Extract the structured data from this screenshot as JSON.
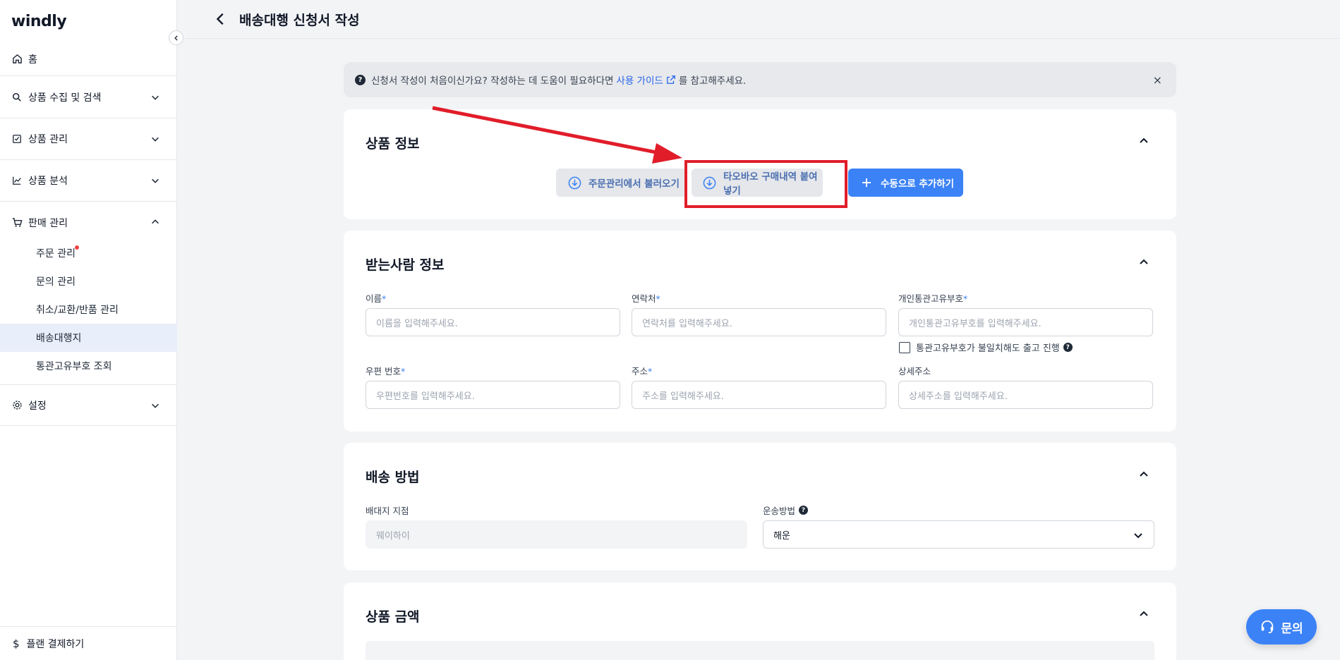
{
  "app": {
    "logo": "windly"
  },
  "sidebar": {
    "home": "홈",
    "sections": [
      {
        "label": "상품 수집 및 검색",
        "icon": "search-icon"
      },
      {
        "label": "상품 관리",
        "icon": "checklist-icon"
      },
      {
        "label": "상품 분석",
        "icon": "chart-icon"
      },
      {
        "label": "판매 관리",
        "icon": "cart-icon",
        "expanded": true
      },
      {
        "label": "설정",
        "icon": "gear-icon"
      }
    ],
    "sub_items": [
      "주문 관리",
      "문의 관리",
      "취소/교환/반품 관리",
      "배송대행지",
      "통관고유부호 조회"
    ],
    "active_sub_item": "배송대행지",
    "plan": "플랜 결제하기"
  },
  "header": {
    "title": "배송대행 신청서 작성"
  },
  "banner": {
    "text_before": "신청서 작성이 처음이신가요? 작성하는 데 도움이 필요하다면",
    "link": "사용 가이드",
    "text_after": "를 참고해주세요.",
    "close": "×"
  },
  "product_info": {
    "title": "상품 정보",
    "buttons": {
      "import_orders": "주문관리에서 불러오기",
      "taobao": "타오바오 구매내역 붙여넣기",
      "manual": "수동으로 추가하기"
    }
  },
  "recipient": {
    "title": "받는사람 정보",
    "fields": {
      "name": {
        "label": "이름",
        "req": "*",
        "placeholder": "이름을 입력해주세요."
      },
      "phone": {
        "label": "연락처",
        "req": "*",
        "placeholder": "연락처를 입력해주세요."
      },
      "customs": {
        "label": "개인통관고유부호",
        "req": "*",
        "placeholder": "개인통관고유부호를 입력해주세요."
      },
      "zip": {
        "label": "우편 번호",
        "req": "*",
        "placeholder": "우편번호를 입력해주세요."
      },
      "address": {
        "label": "주소",
        "req": "*",
        "placeholder": "주소를 입력해주세요."
      },
      "detail": {
        "label": "상세주소",
        "placeholder": "상세주소를 입력해주세요."
      }
    },
    "customs_mismatch_checkbox": "통관고유부호가 불일치해도 출고 진행"
  },
  "shipping": {
    "title": "배송 방법",
    "warehouse_label": "배대지 지점",
    "warehouse_value": "웨이하이",
    "method_label": "운송방법",
    "method_value": "해운"
  },
  "price": {
    "title": "상품 금액"
  },
  "fab": {
    "label": "문의"
  },
  "colors": {
    "accent": "#3b82f6",
    "highlight": "#e11d2a",
    "alert_dot": "#ef4444"
  }
}
